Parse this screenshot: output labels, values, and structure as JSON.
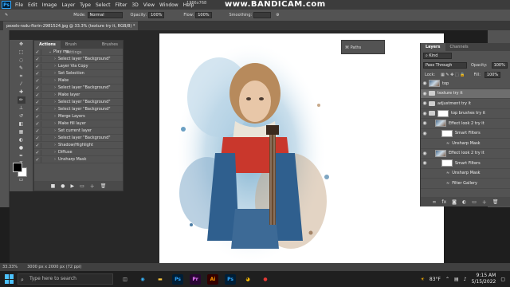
{
  "app": {
    "name": "Ps"
  },
  "menu": [
    "File",
    "Edit",
    "Image",
    "Layer",
    "Type",
    "Select",
    "Filter",
    "3D",
    "View",
    "Window",
    "Help"
  ],
  "resolution_readout": "1366x768",
  "recorder_watermark": "www.BANDICAM.com",
  "options": {
    "mode_label": "Mode:",
    "mode_value": "Normal",
    "opacity_label": "Opacity:",
    "opacity_value": "100%",
    "flow_label": "Flow:",
    "flow_value": "100%",
    "smoothing_label": "Smoothing:"
  },
  "document_tab": "pexels-radu-florin-2981524.jpg @ 33.3% (texture try it, RGB/8) *",
  "actions_panel": {
    "tabs": [
      "Actions",
      "Brush Settings",
      "Brushes"
    ],
    "items": [
      "Play me",
      "Select layer \"Background\"",
      "Layer Via Copy",
      "Set Selection",
      "Make",
      "Select layer \"Background\"",
      "Make layer",
      "Select layer \"Background\"",
      "Select layer \"Background\"",
      "Merge Layers",
      "Make fill layer",
      "Set current layer",
      "Select layer \"Background\"",
      "Shadow/Highlight",
      "Diffuse",
      "Unsharp Mask"
    ]
  },
  "paths_panel": {
    "label": "Paths"
  },
  "layers_panel": {
    "tabs": [
      "Layers",
      "Channels"
    ],
    "kind_label": "Kind",
    "blend_mode": "Pass Through",
    "opacity_label": "Opacity:",
    "opacity_value": "100%",
    "lock_label": "Lock:",
    "fill_label": "Fill:",
    "fill_value": "100%",
    "layers": [
      {
        "name": "top",
        "type": "image"
      },
      {
        "name": "texture try it",
        "type": "folder",
        "selected": true
      },
      {
        "name": "adjustment try it",
        "type": "folder"
      },
      {
        "name": "top brushes try it",
        "type": "folder-mask"
      },
      {
        "name": "Effect look 2 try it",
        "type": "image"
      },
      {
        "name": "Smart Filters",
        "type": "mask"
      },
      {
        "name": "Unsharp Mask",
        "type": "filter"
      },
      {
        "name": "Effect look 2 try it",
        "type": "image"
      },
      {
        "name": "Smart Filters",
        "type": "mask"
      },
      {
        "name": "Unsharp Mask",
        "type": "filter"
      },
      {
        "name": "Filter Gallery",
        "type": "filter"
      }
    ]
  },
  "status_bar": {
    "zoom": "33.33%",
    "doc_size": "3000 px x 2000 px (72 ppi)"
  },
  "taskbar": {
    "search_placeholder": "Type here to search",
    "apps": [
      {
        "label": "Ps",
        "color": "#31a8ff",
        "bg": "#001e36"
      },
      {
        "label": "Pr",
        "color": "#ea77ff",
        "bg": "#2a0634"
      },
      {
        "label": "Ai",
        "color": "#ff9a00",
        "bg": "#330000"
      },
      {
        "label": "Ps",
        "color": "#31a8ff",
        "bg": "#001e36"
      }
    ],
    "weather": "83°F",
    "time": "9:15 AM",
    "date": "5/15/2022"
  },
  "colors": {
    "accent": "#31a8ff",
    "ui_dark": "#535353",
    "canvas": "#ffffff"
  }
}
